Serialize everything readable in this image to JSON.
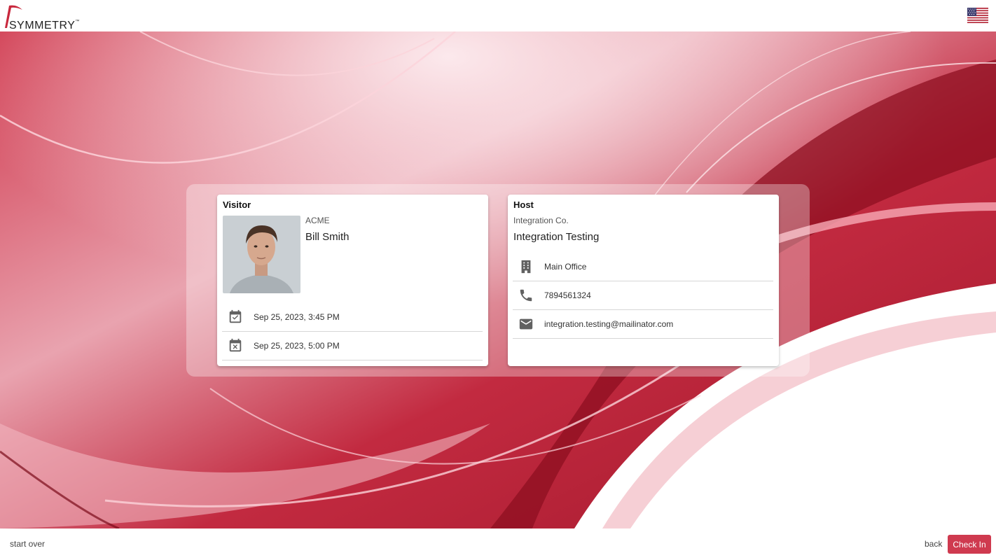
{
  "header": {
    "logo_text": "SYMMETRY",
    "logo_tm": "™",
    "language_flag": "us-flag-icon"
  },
  "visitor": {
    "title": "Visitor",
    "company": "ACME",
    "name": "Bill Smith",
    "rows": [
      {
        "icon": "calendar-check-icon",
        "text": "Sep 25, 2023, 3:45 PM"
      },
      {
        "icon": "calendar-remove-icon",
        "text": "Sep 25, 2023, 5:00 PM"
      }
    ]
  },
  "host": {
    "title": "Host",
    "company": "Integration Co.",
    "name": "Integration Testing",
    "rows": [
      {
        "icon": "building-icon",
        "text": "Main Office"
      },
      {
        "icon": "phone-icon",
        "text": "7894561324"
      },
      {
        "icon": "email-icon",
        "text": "integration.testing@mailinator.com"
      }
    ]
  },
  "footer": {
    "start_over": "start over",
    "back": "back",
    "check_in": "Check In"
  },
  "colors": {
    "accent": "#cf3a4f",
    "background_red": "#c8283d",
    "icon_gray": "#616161"
  }
}
